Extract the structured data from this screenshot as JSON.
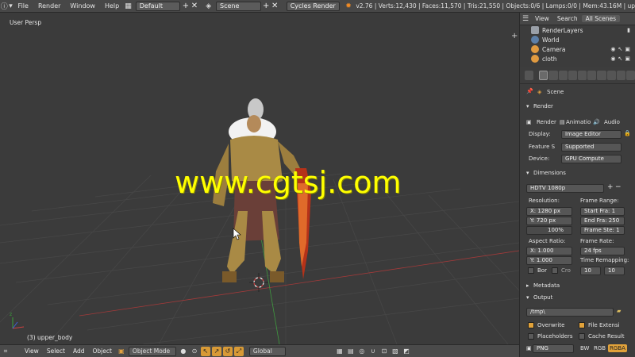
{
  "topbar": {
    "menu": [
      "File",
      "Render",
      "Window",
      "Help"
    ],
    "layout": "Default",
    "scene": "Scene",
    "engine": "Cycles Render",
    "stats": "v2.76 | Verts:12,430 | Faces:11,570 | Tris:21,550 | Objects:0/6 | Lamps:0/0 | Mem:43.16M | up"
  },
  "viewport": {
    "label": "User Persp",
    "object_label": "(3) upper_body",
    "watermark": "www.cgtsj.com"
  },
  "bottombar": {
    "view": "View",
    "select": "Select",
    "add": "Add",
    "object": "Object",
    "mode": "Object Mode",
    "orientation": "Global"
  },
  "outliner": {
    "tabs": [
      "View",
      "Search",
      "All Scenes"
    ],
    "items": [
      {
        "label": "RenderLayers",
        "icon": "render-layers-icon"
      },
      {
        "label": "World",
        "icon": "world-icon"
      },
      {
        "label": "Camera",
        "icon": "camera-icon"
      },
      {
        "label": "cloth",
        "icon": "mesh-icon"
      }
    ]
  },
  "properties": {
    "context": "Scene",
    "render_panel": "Render",
    "render_buttons": [
      "Render",
      "Animatio",
      "Audio"
    ],
    "display_label": "Display:",
    "display_value": "Image Editor",
    "feature_label": "Feature S",
    "feature_value": "Supported",
    "device_label": "Device:",
    "device_value": "GPU Compute",
    "dimensions_panel": "Dimensions",
    "preset": "HDTV 1080p",
    "resolution_label": "Resolution:",
    "res_x": "X:  1280 px",
    "res_y": "Y:   720 px",
    "res_pct": "100%",
    "frame_range_label": "Frame Range:",
    "start_frame": "Start Fra:  1",
    "end_frame": "End Fra: 250",
    "frame_step": "Frame Ste: 1",
    "aspect_label": "Aspect Ratio:",
    "aspect_x": "X:    1.000",
    "aspect_y": "Y:    1.000",
    "frame_rate_label": "Frame Rate:",
    "fps": "24 fps",
    "time_remap_label": "Time Remapping:",
    "remap_old": "10",
    "remap_new": "10",
    "border_label": "Bor",
    "crop_label": "Cro",
    "metadata_panel": "Metadata",
    "output_panel": "Output",
    "output_path": "/tmp\\",
    "overwrite": "Overwrite",
    "file_ext": "File Extensi",
    "placeholders": "Placeholders",
    "cache_result": "Cache Result",
    "format": "PNG",
    "bw": "BW",
    "rgb": "RGB",
    "rgba": "RGBA"
  },
  "colors": {
    "accent": "#e1a23a",
    "watermark": "#ffff00",
    "grid_red": "#a33a3a",
    "grid_green": "#3f9a3f"
  }
}
